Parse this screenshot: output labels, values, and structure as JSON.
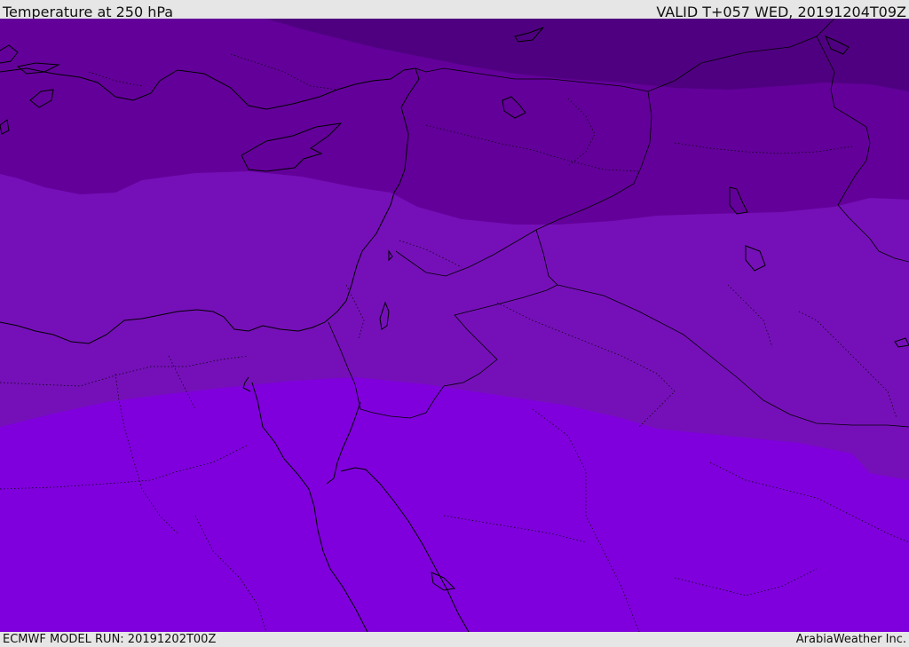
{
  "header": {
    "title": "Temperature at 250 hPa",
    "valid_time": "VALID T+057 WED, 20191204T09Z"
  },
  "footer": {
    "model_run": "ECMWF MODEL RUN: 20191202T00Z",
    "credit": "ArabiaWeather Inc."
  },
  "map": {
    "variable": "temperature",
    "pressure_level_hpa": 250,
    "region": "Eastern Mediterranean / Levant / Egypt",
    "shading_bands": [
      {
        "band": "coldest",
        "color": "#4f0080"
      },
      {
        "band": "cold",
        "color": "#63009a"
      },
      {
        "band": "mid",
        "color": "#7510b8"
      },
      {
        "band": "warm",
        "color": "#7f00dc"
      }
    ],
    "coastline_color": "#000000",
    "border_style": "dotted"
  }
}
